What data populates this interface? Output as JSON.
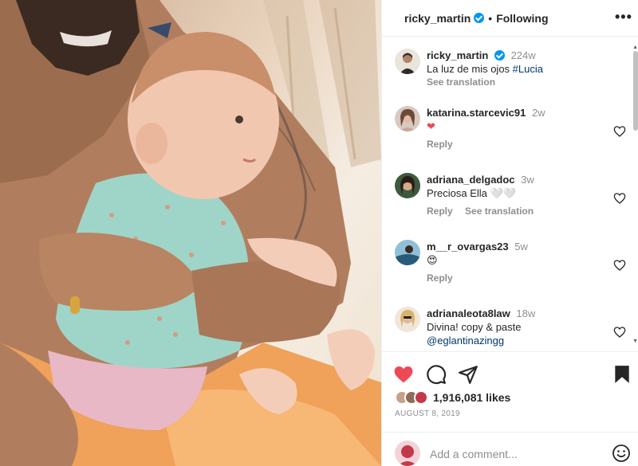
{
  "header": {
    "username": "ricky_martin",
    "following_label": "Following",
    "more_icon": "more-horizontal-icon"
  },
  "caption": {
    "username": "ricky_martin",
    "time": "224w",
    "text": "La luz de mis ojos ",
    "hashtag": "#Lucia",
    "see_translation": "See translation"
  },
  "comments": [
    {
      "username": "katarina.starcevic91",
      "time": "2w",
      "text": "❤",
      "reply": "Reply",
      "see_translation": ""
    },
    {
      "username": "adriana_delgadoc",
      "time": "3w",
      "text": "Preciosa Ella 🤍🤍",
      "reply": "Reply",
      "see_translation": "See translation"
    },
    {
      "username": "m__r_ovargas23",
      "time": "5w",
      "text": "😍",
      "reply": "Reply",
      "see_translation": ""
    },
    {
      "username": "adrianaleota8law",
      "time": "18w",
      "text": "Divina! copy & paste ",
      "mention": "@eglantinazingg",
      "reply": "",
      "see_translation": ""
    }
  ],
  "actions": {
    "likes": "1,916,081 likes",
    "date": "AUGUST 8, 2019",
    "add_comment_placeholder": "Add a comment..."
  },
  "colors": {
    "like_red": "#ed4956",
    "verified_blue": "#0095f6",
    "link_blue": "#00376b",
    "secondary_gray": "#8e8e8e"
  }
}
